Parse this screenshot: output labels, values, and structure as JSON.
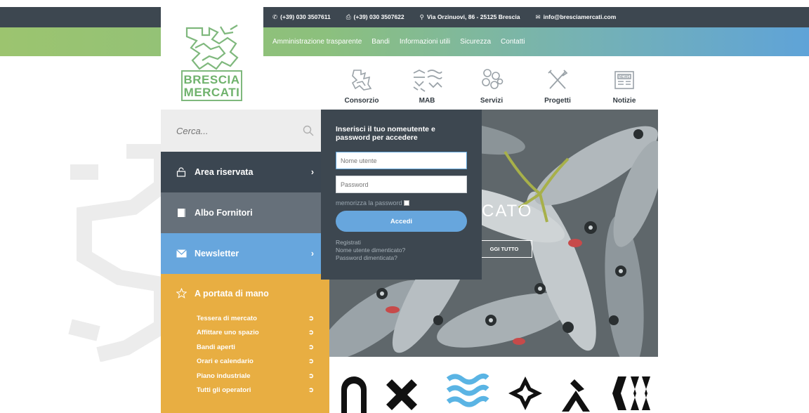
{
  "header": {
    "contacts": [
      {
        "icon": "phone-icon",
        "text": "(+39) 030 3507611"
      },
      {
        "icon": "fax-icon",
        "text": "(+39) 030 3507622"
      },
      {
        "icon": "location-pin-icon",
        "text": "Via Orzinuovi, 86 - 25125 Brescia"
      },
      {
        "icon": "mail-icon",
        "text": "info@bresciamercati.com"
      }
    ],
    "nav": [
      "Amministrazione trasparente",
      "Bandi",
      "Informazioni utili",
      "Sicurezza",
      "Contatti"
    ]
  },
  "logo": {
    "line1": "BRESCIA",
    "line2": "MERCATI"
  },
  "icon_menu": [
    {
      "label": "Consorzio",
      "icon": "lion-crest-icon"
    },
    {
      "label": "MAB",
      "icon": "mab-pattern-icon"
    },
    {
      "label": "Servizi",
      "icon": "hexagons-icon"
    },
    {
      "label": "Progetti",
      "icon": "tools-icon"
    },
    {
      "label": "Notizie",
      "icon": "newspaper-icon"
    }
  ],
  "search": {
    "placeholder": "Cerca..."
  },
  "sidebar": {
    "area": "Area riservata",
    "albo": "Albo Fornitori",
    "newsletter": "Newsletter",
    "portata_title": "A portata di mano",
    "links": [
      "Tessera di mercato",
      "Affittare uno spazio",
      "Bandi aperti",
      "Orari e calendario",
      "Piano industriale",
      "Tutti gli operatori"
    ]
  },
  "login": {
    "title": "Inserisci il tuo nomeutente e password per accedere",
    "username_placeholder": "Nome utente",
    "password_placeholder": "Password",
    "remember": "memorizza la password",
    "submit": "Accedi",
    "links": [
      "Registrati",
      "Nome utente dimenticato?",
      "Password dimenticata?"
    ]
  },
  "hero": {
    "title": "CATO",
    "button": "GGI TUTTO"
  },
  "colors": {
    "dark": "#3d4750",
    "green": "#9cc46f",
    "blue": "#67a6dd",
    "orange": "#e8ae42"
  }
}
